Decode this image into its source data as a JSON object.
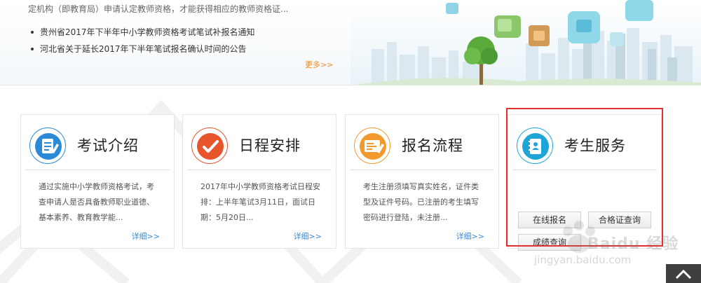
{
  "banner": {
    "intro": "定机构（即教育局）申请认定教师资格，才能获得相应的教师资格证...",
    "news": [
      "贵州省2017年下半年中小学教师资格考试笔试补报名通知",
      "河北省关于延长2017年下半年笔试报名确认时间的公告"
    ],
    "more_label": "更多>>"
  },
  "cards": [
    {
      "title": "考试介绍",
      "icon": "document-edit-icon",
      "accent": "#2a8ad8",
      "desc": "通过实施中小学教师资格考试，考查申请人是否具备教师职业道德、基本素养、教育教学能...",
      "detail_label": "详细>>"
    },
    {
      "title": "日程安排",
      "icon": "checkmark-icon",
      "accent": "#e8552c",
      "desc": "2017年中小学教师资格考试日程安排：上半年笔试3月11日，面试日期：5月20日...",
      "detail_label": "详细>>"
    },
    {
      "title": "报名流程",
      "icon": "registration-form-icon",
      "accent": "#f29a2e",
      "desc": "考生注册须填写真实姓名，证件类型及证件号码。已注册的考生填写密码进行登陆，未注册...",
      "detail_label": "详细>>"
    },
    {
      "title": "考生服务",
      "icon": "contact-book-icon",
      "accent": "#1ea5d8",
      "buttons": [
        "在线报名",
        "合格证查询",
        "成绩查询"
      ]
    }
  ],
  "watermark": {
    "brand": "Baidu 经验",
    "url": "jingyan.baidu.com"
  },
  "colors": {
    "highlight": "#e03030",
    "link": "#3a8ad6",
    "more": "#f28a1c"
  }
}
